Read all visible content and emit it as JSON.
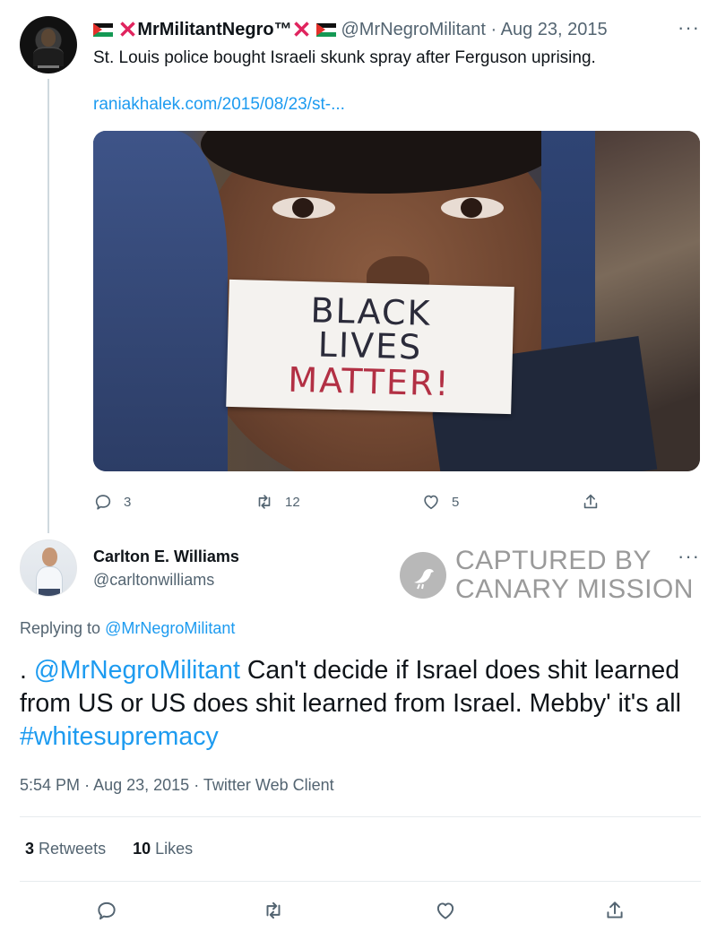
{
  "parent_tweet": {
    "display_name": "MrMilitantNegro™",
    "cross_symbol": "❌",
    "handle": "@MrNegroMilitant",
    "separator": "·",
    "date": "Aug 23, 2015",
    "text": "St. Louis police bought Israeli skunk spray after Ferguson uprising.",
    "link": "raniakhalek.com/2015/08/23/st-...",
    "image": {
      "sign_lines": [
        "BLACK",
        "LIVES",
        "MATTER!"
      ]
    },
    "actions": {
      "replies": "3",
      "retweets": "12",
      "likes": "5"
    },
    "more_icon": "···"
  },
  "main_tweet": {
    "display_name": "Carlton E. Williams",
    "handle": "@carltonwilliams",
    "more_icon": "···",
    "replying_prefix": "Replying to",
    "replying_to": "@MrNegroMilitant",
    "body": {
      "prefix": ". ",
      "mention": "@MrNegroMilitant",
      "text": " Can't decide if Israel does shit learned from US or US does shit learned from Israel. Mebby' it's all ",
      "hashtag": "#whitesupremacy"
    },
    "time": "5:54 PM",
    "date": "Aug 23, 2015",
    "client": "Twitter Web Client",
    "retweets_count": "3",
    "retweets_label": "Retweets",
    "likes_count": "10",
    "likes_label": "Likes"
  },
  "watermark": {
    "line1": "CAPTURED BY",
    "line2": "CANARY MISSION"
  },
  "colors": {
    "link": "#1d9bf0",
    "secondary_text": "#536471",
    "primary_text": "#0f1419",
    "divider": "#e7ebee"
  },
  "icons": [
    "reply-icon",
    "retweet-icon",
    "like-icon",
    "share-icon",
    "more-icon"
  ]
}
